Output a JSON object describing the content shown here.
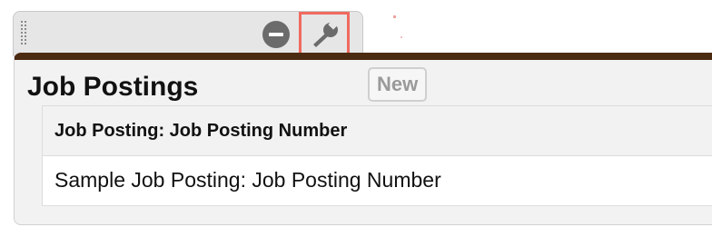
{
  "panel": {
    "title": "Job Postings",
    "new_label": "New"
  },
  "toolbar": {
    "remove_icon": "minus-circle-icon",
    "settings_icon": "wrench-icon",
    "handle_icon": "drag-grip-icon"
  },
  "table": {
    "columns": [
      "Job Posting: Job Posting Number"
    ],
    "rows": [
      [
        "Sample Job Posting: Job Posting Number"
      ]
    ]
  },
  "colors": {
    "accent_border": "#4b2a12",
    "highlight": "#f06a60"
  }
}
